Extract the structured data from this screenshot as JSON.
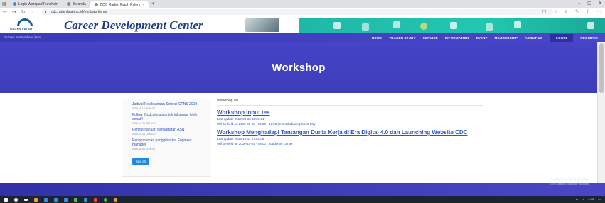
{
  "browser": {
    "tabs": [
      {
        "label": "Login Wordpad Punchain",
        "active": false
      },
      {
        "label": "Beranda",
        "active": false
      },
      {
        "label": "CDC Raden Fatah Palem",
        "active": true
      }
    ],
    "new_tab_symbol": "+",
    "url": "cdc.radenfatah.ac.id/front/workshop"
  },
  "site": {
    "logo_text": "RADEN FATAH",
    "brand_title": "Career Development Center",
    "tagline": "Sukses anda sukses kami",
    "menu": [
      "HOME",
      "TRACER STUDY",
      "SERVICE",
      "INFORMATION",
      "EVENT",
      "MEMBERSHIP",
      "ABOUT US",
      "LOGIN",
      "REGISTER"
    ],
    "hero_title": "Workshop"
  },
  "sidebar": {
    "items": [
      {
        "title": "Jadwal Pelaksanaan Seleksi CPNS 2019",
        "date": "2019-11-13 09:48:00"
      },
      {
        "title": "Follow @cdcuinrafa untuk informasi lebih cepat!!",
        "date": "2019-10-23 08:18:00"
      },
      {
        "title": "Pemberitahuan pendaftaran ASN",
        "date": "2019-10-18 14:58:00"
      },
      {
        "title": "Pengumuman panggilan tes Engineer manager",
        "date": "2019-08-30 11:06:00"
      }
    ],
    "see_all": "See all"
  },
  "main": {
    "section_label": "Workshop list",
    "posts": [
      {
        "title": "Workshop input tes",
        "last_update": "Last update 2019-08-15 15:51:01",
        "held": "Will be held on 2019-08-18 - 09:00 - 13:00 | Inn Jakabaring Sport City"
      },
      {
        "title": "Workshop Menghadapi Tantangan Dunia Kerja di Era Digital 4.0 dan Launching Website CDC",
        "last_update": "Last update 2019-10-11 17:52:08",
        "held": "Will be held on 2019-10-14 - 08:00 | Academic Center"
      }
    ]
  },
  "watermark": {
    "line1": "Activate Windows",
    "line2": "Go to Settings to activate Windows."
  },
  "taskbar": {
    "tray_time": "9:03"
  }
}
